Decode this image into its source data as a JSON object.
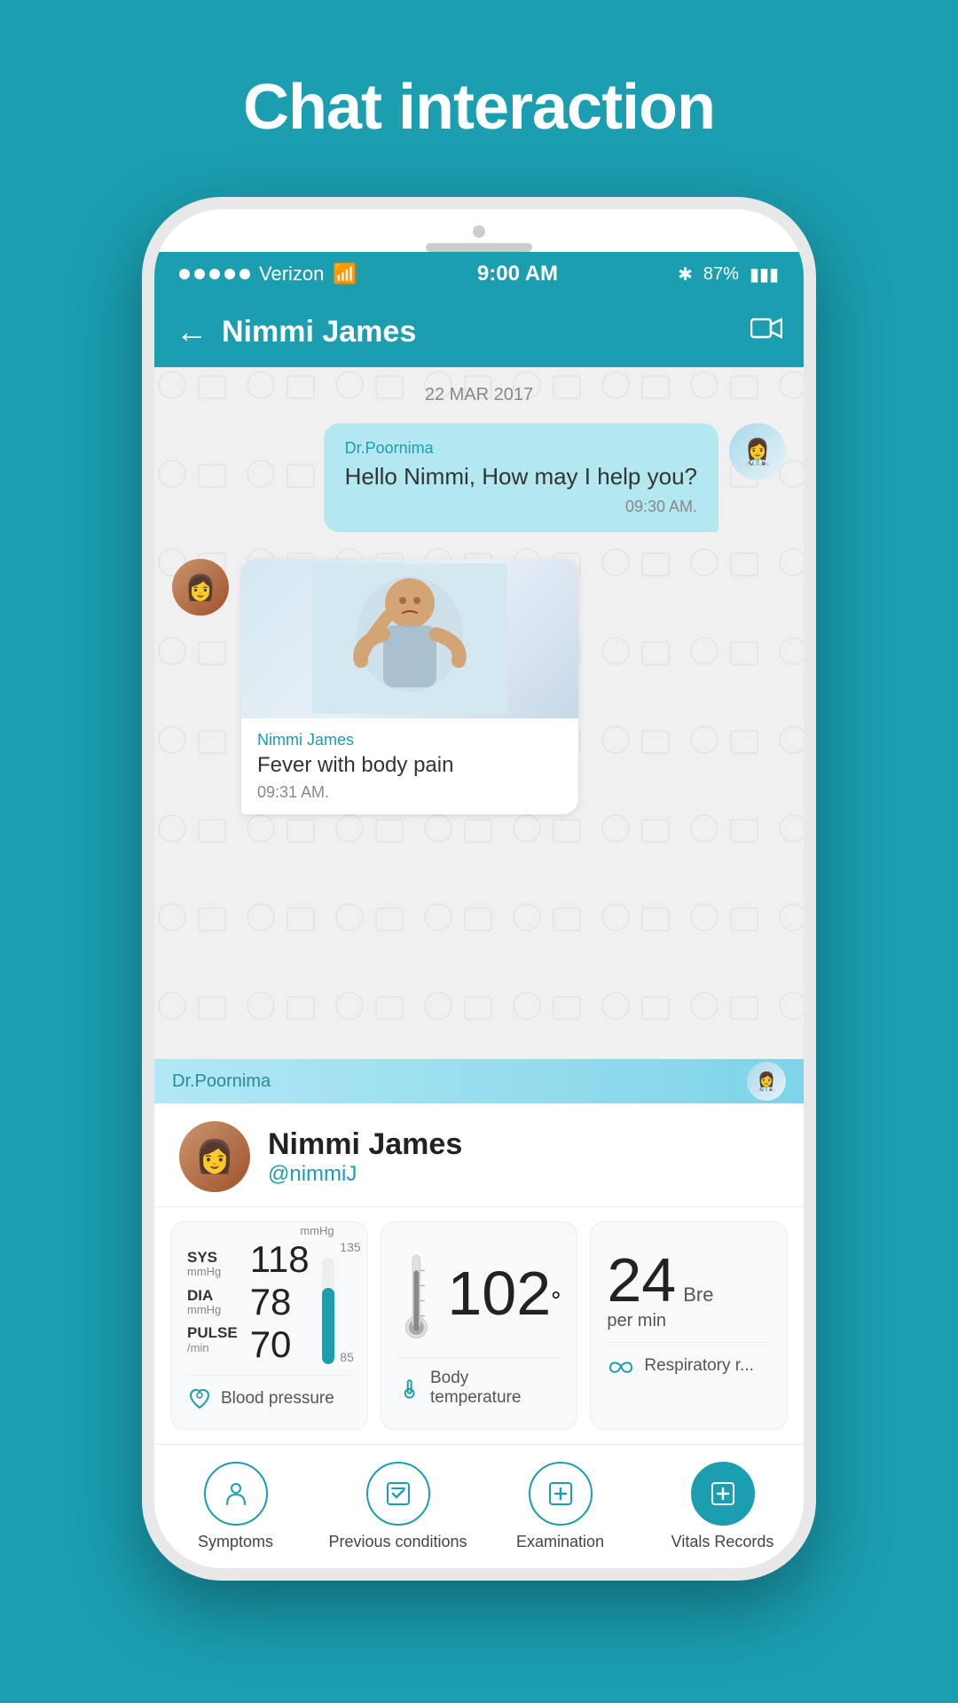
{
  "page": {
    "title": "Chat interaction",
    "background_color": "#1a9eb0"
  },
  "status_bar": {
    "carrier": "Verizon",
    "time": "9:00 AM",
    "battery": "87%",
    "signal_dots": 5
  },
  "nav_header": {
    "title": "Nimmi James",
    "back_label": "←",
    "video_icon": "📹"
  },
  "chat": {
    "date": "22 MAR 2017",
    "doctor_message": {
      "sender": "Dr.Poornima",
      "text": "Hello Nimmi, How may I help you?",
      "time": "09:30 AM."
    },
    "patient_message": {
      "sender": "Nimmi James",
      "text": "Fever with body pain",
      "time": "09:31 AM."
    },
    "typing_indicator": "Dr.Poornima"
  },
  "profile": {
    "name": "Nimmi James",
    "handle": "@nimmiJ"
  },
  "vitals": [
    {
      "id": "blood-pressure",
      "label": "Blood pressure",
      "sys_abbr": "SYS",
      "sys_unit": "mmHg",
      "sys_value": "118",
      "dia_abbr": "DIA",
      "dia_unit": "mmHg",
      "dia_value": "78",
      "pulse_abbr": "PULSE",
      "pulse_unit": "/min",
      "pulse_value": "70",
      "bar_unit": "mmHg",
      "bar_high": "135",
      "bar_low": "85"
    },
    {
      "id": "body-temperature",
      "label": "Body temperature",
      "value": "102",
      "degree": "°"
    },
    {
      "id": "respiratory-rate",
      "label": "Respiratory r...",
      "value": "24",
      "unit": "Bre",
      "per": "per min"
    }
  ],
  "bottom_nav": [
    {
      "id": "symptoms",
      "label": "Symptoms",
      "icon": "👤",
      "active": false
    },
    {
      "id": "previous-conditions",
      "label": "Previous conditions",
      "icon": "📊",
      "active": false
    },
    {
      "id": "examination",
      "label": "Examination",
      "icon": "➕",
      "active": false
    },
    {
      "id": "vitals-records",
      "label": "Vitals Records",
      "icon": "➕",
      "active": true
    }
  ]
}
